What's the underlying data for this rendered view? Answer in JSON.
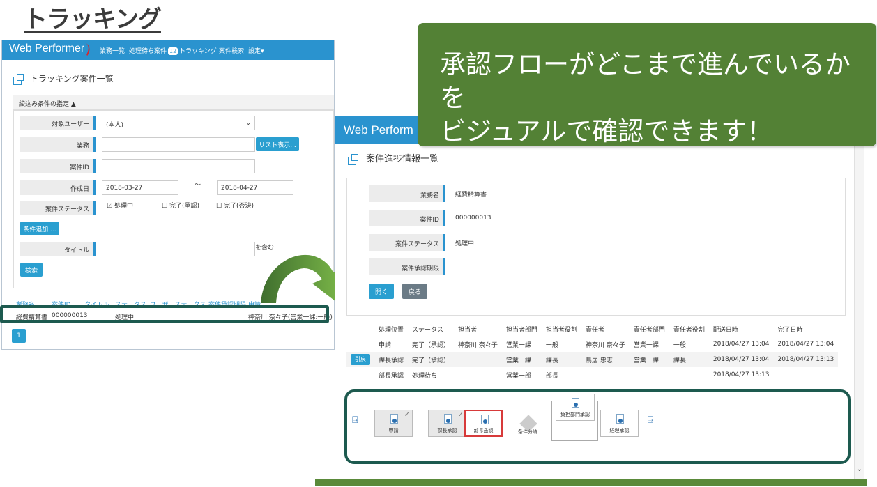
{
  "page_title": "トラッキング",
  "callout": {
    "line1": "承認フローがどこまで進んでいるかを",
    "line2": "ビジュアルで確認できます！"
  },
  "back_window": {
    "logo": "Web Performer",
    "nav": [
      "業務一覧",
      "処理待ち案件",
      "トラッキング",
      "案件検索",
      "設定▾"
    ],
    "nav_badge": "12",
    "section_title": "トラッキング案件一覧",
    "filter_toggle": "絞込み条件の指定 ▲",
    "fields": {
      "target_user": {
        "label": "対象ユーザー",
        "value": "(本人)"
      },
      "business": {
        "label": "業務",
        "button": "リスト表示..."
      },
      "case_id": {
        "label": "案件ID"
      },
      "created": {
        "label": "作成日",
        "from": "2018-03-27",
        "sep": "～",
        "to": "2018-04-27"
      },
      "status": {
        "label": "案件ステータス",
        "opt1": "処理中",
        "opt2": "完了(承認)",
        "opt3": "完了(否決)"
      },
      "add_cond": "条件追加 ...",
      "title": {
        "label": "タイトル",
        "suffix": "を含む"
      },
      "search": "検索"
    },
    "table": {
      "headers": [
        "業務名",
        "案件ID",
        "タイトル",
        "ステータス",
        "ユーザーステータス",
        "案件承認期限",
        "申請"
      ],
      "row": {
        "business": "経費精算書",
        "id": "000000013",
        "status": "処理中",
        "applicant": "神奈川 奈々子(営業一課:一般)"
      }
    },
    "page": "1"
  },
  "front_window": {
    "logo": "Web Perform",
    "section_title": "案件進捗情報一覧",
    "info": [
      {
        "label": "業務名",
        "value": "経費精算書"
      },
      {
        "label": "案件ID",
        "value": "000000013"
      },
      {
        "label": "案件ステータス",
        "value": "処理中"
      },
      {
        "label": "案件承認期限",
        "value": ""
      }
    ],
    "open_btn": "開く",
    "back_btn": "戻る",
    "table_headers": [
      "処理位置",
      "ステータス",
      "担当者",
      "担当者部門",
      "担当者役割",
      "責任者",
      "責任者部門",
      "責任者役割",
      "配送日時",
      "完了日時"
    ],
    "rows": [
      [
        "申請",
        "完了（承認）",
        "神奈川 奈々子",
        "営業一課",
        "一般",
        "神奈川 奈々子",
        "営業一課",
        "一般",
        "2018/04/27 13:04",
        "2018/04/27 13:04"
      ],
      [
        "課長承認",
        "完了（承認）",
        "",
        "営業一課",
        "課長",
        "鳥居 忠志",
        "営業一課",
        "課長",
        "2018/04/27 13:04",
        "2018/04/27 13:13"
      ],
      [
        "部長承認",
        "処理待ち",
        "",
        "営業一部",
        "部長",
        "",
        "",
        "",
        "2018/04/27 13:13",
        ""
      ]
    ],
    "pull_back": "引戻",
    "flow": {
      "n1": "申請",
      "n2": "課長承認",
      "n3": "部長承認",
      "branch": "条件分岐",
      "n4": "負担部門承認",
      "n5": "経理承認"
    }
  }
}
